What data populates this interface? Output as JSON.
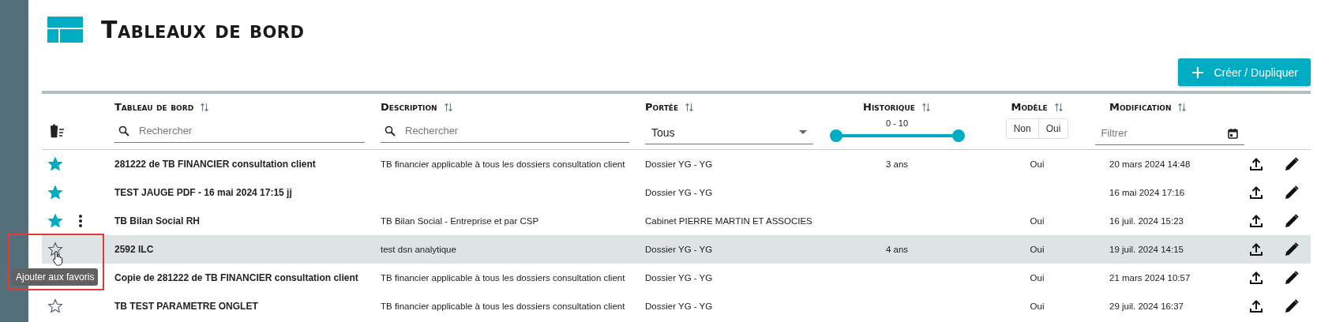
{
  "page": {
    "title": "Tableaux de bord"
  },
  "create_button": {
    "label": "Créer / Dupliquer"
  },
  "columns": [
    {
      "kind": "name",
      "label": "Tableau de bord",
      "placeholder": "Rechercher"
    },
    {
      "kind": "description",
      "label": "Description",
      "placeholder": "Rechercher"
    },
    {
      "kind": "scope",
      "label": "Portée",
      "value": "Tous"
    },
    {
      "kind": "history",
      "label": "Historique",
      "reading": "0 - 10",
      "thumbs": [
        {
          "level": 0
        },
        {
          "level": 1
        }
      ]
    },
    {
      "kind": "model",
      "label": "Modèle",
      "options": [
        {
          "label": "Non",
          "selected": false
        },
        {
          "label": "Oui",
          "selected": false
        }
      ]
    },
    {
      "kind": "modified",
      "label": "Modification",
      "placeholder": "Filtrer"
    }
  ],
  "rows": [
    {
      "favorite": true,
      "menu": false,
      "hovered": false,
      "name": "281222 de TB FINANCIER consultation client",
      "description": "TB financier applicable à tous les dossiers consultation client",
      "scope": "Dossier YG - YG",
      "history": "3 ans",
      "model": "Oui",
      "modified": "20 mars 2024 14:48"
    },
    {
      "favorite": true,
      "menu": false,
      "hovered": false,
      "name": "TEST JAUGE PDF - 16 mai 2024 17:15 jj",
      "scope": "Dossier YG - YG",
      "modified": "16 mai 2024 17:16"
    },
    {
      "favorite": true,
      "menu": true,
      "hovered": false,
      "name": "TB Bilan Social RH",
      "description": "TB Bilan Social - Entreprise et par CSP",
      "scope": "Cabinet PIERRE MARTIN ET ASSOCIES",
      "model": "Oui",
      "modified": "16 juil. 2024 15:23"
    },
    {
      "favorite": false,
      "menu": false,
      "hovered": true,
      "name": "2592 ILC",
      "description": "test dsn analytique",
      "scope": "Dossier YG - YG",
      "history": "4 ans",
      "model": "Oui",
      "modified": "19 juil. 2024 14:15"
    },
    {
      "menu": false,
      "hovered": false,
      "name": "Copie de 281222 de TB FINANCIER consultation client",
      "description": "TB financier applicable à tous les dossiers consultation client",
      "scope": "Dossier YG - YG",
      "model": "Oui",
      "modified": "21 mars 2024 10:57"
    },
    {
      "favorite": false,
      "menu": false,
      "hovered": false,
      "name": "TB TEST PARAMETRE ONGLET",
      "description": "TB financier applicable à tous les dossiers consultation client",
      "scope": "Dossier YG - YG",
      "model": "Oui",
      "modified": "29 juil. 2024 16:37"
    }
  ],
  "tooltip": {
    "text": "Ajouter aux favoris",
    "framed": true
  }
}
